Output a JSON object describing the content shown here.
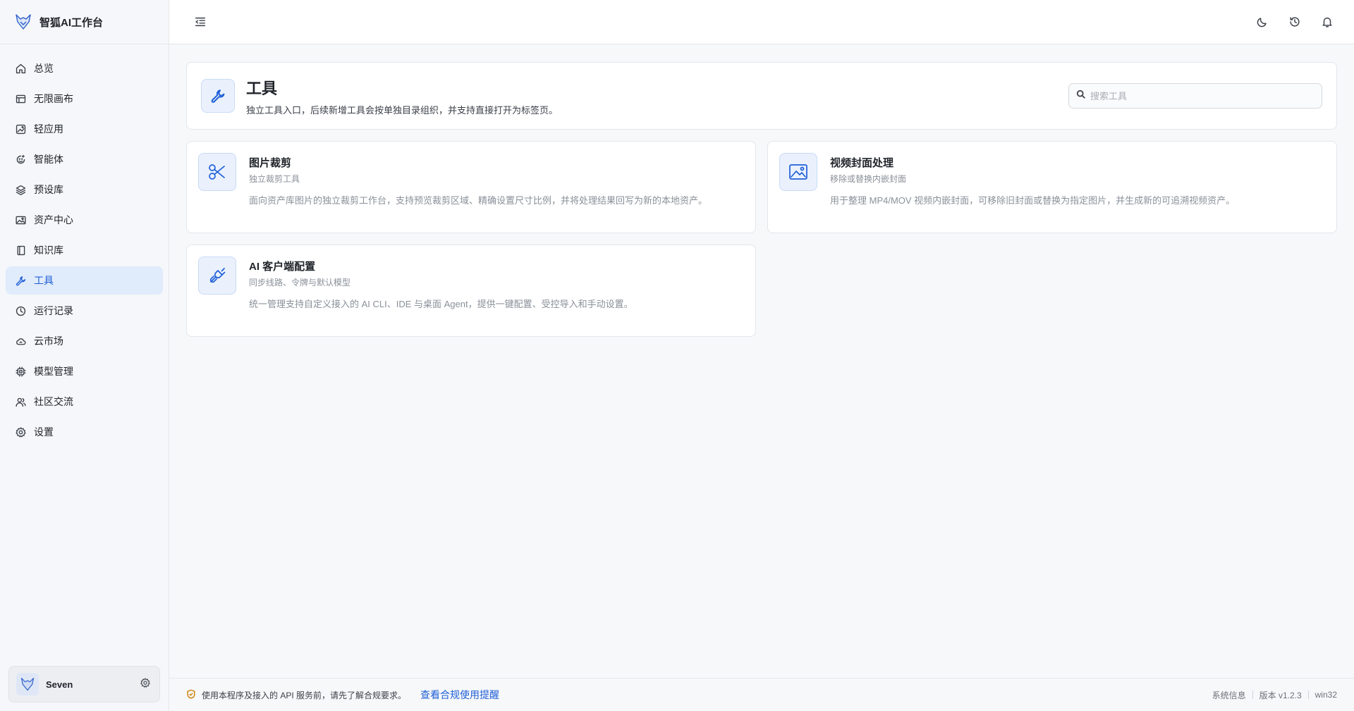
{
  "app": {
    "name": "智狐AI工作台"
  },
  "sidebar": {
    "items": [
      {
        "label": "总览",
        "icon": "home-icon"
      },
      {
        "label": "无限画布",
        "icon": "canvas-icon"
      },
      {
        "label": "轻应用",
        "icon": "image-app-icon"
      },
      {
        "label": "智能体",
        "icon": "agent-icon"
      },
      {
        "label": "预设库",
        "icon": "layers-icon"
      },
      {
        "label": "资产中心",
        "icon": "image-icon"
      },
      {
        "label": "知识库",
        "icon": "book-icon"
      },
      {
        "label": "工具",
        "icon": "wrench-icon",
        "active": true
      },
      {
        "label": "运行记录",
        "icon": "history-icon"
      },
      {
        "label": "云市场",
        "icon": "cloud-icon"
      },
      {
        "label": "模型管理",
        "icon": "chip-icon"
      },
      {
        "label": "社区交流",
        "icon": "users-icon"
      },
      {
        "label": "设置",
        "icon": "gear-icon"
      }
    ]
  },
  "user": {
    "name": "Seven"
  },
  "header": {
    "title": "工具",
    "description": "独立工具入口，后续新增工具会按单独目录组织，并支持直接打开为标签页。",
    "search_placeholder": "搜索工具"
  },
  "tools": [
    {
      "title": "图片裁剪",
      "subtitle": "独立裁剪工具",
      "description": "面向资产库图片的独立裁剪工作台，支持预览裁剪区域、精确设置尺寸比例，并将处理结果回写为新的本地资产。",
      "icon": "scissors-icon"
    },
    {
      "title": "视频封面处理",
      "subtitle": "移除或替换内嵌封面",
      "description": "用于整理 MP4/MOV 视频内嵌封面，可移除旧封面或替换为指定图片，并生成新的可追溯视频资产。",
      "icon": "picture-icon"
    },
    {
      "title": "AI 客户端配置",
      "subtitle": "同步线路、令牌与默认模型",
      "description": "统一管理支持自定义接入的 AI CLI、IDE 与桌面 Agent，提供一键配置、受控导入和手动设置。",
      "icon": "plug-icon"
    }
  ],
  "footer": {
    "notice": "使用本程序及接入的 API 服务前，请先了解合规要求。",
    "link": "查看合规使用提醒",
    "system_info": "系统信息",
    "version": "版本 v1.2.3",
    "platform": "win32"
  },
  "colors": {
    "accent": "#1f5fd6",
    "active_bg": "#e0ebfb",
    "warning": "#d08a1c"
  }
}
